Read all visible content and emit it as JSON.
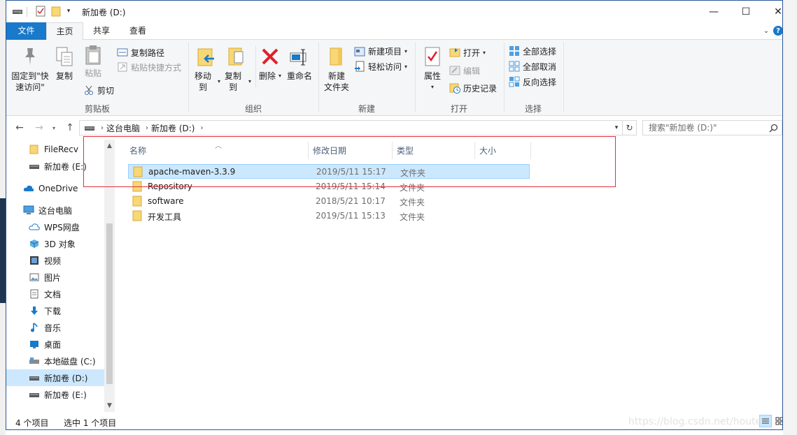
{
  "window": {
    "title": "新加卷 (D:)",
    "controls": {
      "minimize": "—",
      "maximize": "☐",
      "close": "✕"
    }
  },
  "ribbon_tabs": {
    "file": "文件",
    "home": "主页",
    "share": "共享",
    "view": "查看"
  },
  "ribbon": {
    "clipboard": {
      "pin_line1": "固定到\"快",
      "pin_line2": "速访问\"",
      "copy": "复制",
      "paste": "粘贴",
      "copy_path": "复制路径",
      "paste_shortcut": "粘贴快捷方式",
      "cut": "剪切",
      "label": "剪贴板"
    },
    "organize": {
      "move_to": "移动到",
      "copy_to": "复制到",
      "delete": "删除",
      "rename": "重命名",
      "label": "组织"
    },
    "new": {
      "new_folder_line1": "新建",
      "new_folder_line2": "文件夹",
      "new_item": "新建项目",
      "easy_access": "轻松访问",
      "label": "新建"
    },
    "open": {
      "properties": "属性",
      "open": "打开",
      "edit": "编辑",
      "history": "历史记录",
      "label": "打开"
    },
    "select": {
      "select_all": "全部选择",
      "select_none": "全部取消",
      "invert": "反向选择",
      "label": "选择"
    }
  },
  "address": {
    "crumbs": [
      "这台电脑",
      "新加卷 (D:)"
    ],
    "search_placeholder": "搜索\"新加卷 (D:)\""
  },
  "nav_pane": {
    "items": [
      {
        "label": "FileRecv",
        "icon": "folder-icon"
      },
      {
        "label": "新加卷 (E:)",
        "icon": "drive-icon"
      },
      {
        "label": "OneDrive",
        "icon": "cloud-icon"
      },
      {
        "label": "这台电脑",
        "icon": "computer-icon"
      },
      {
        "label": "WPS网盘",
        "icon": "cloud-icon"
      },
      {
        "label": "3D 对象",
        "icon": "cube-icon"
      },
      {
        "label": "视频",
        "icon": "video-icon"
      },
      {
        "label": "图片",
        "icon": "picture-icon"
      },
      {
        "label": "文档",
        "icon": "document-icon"
      },
      {
        "label": "下载",
        "icon": "download-icon"
      },
      {
        "label": "音乐",
        "icon": "music-icon"
      },
      {
        "label": "桌面",
        "icon": "desktop-icon"
      },
      {
        "label": "本地磁盘 (C:)",
        "icon": "drive-icon"
      },
      {
        "label": "新加卷 (D:)",
        "icon": "drive-icon",
        "selected": true
      },
      {
        "label": "新加卷 (E:)",
        "icon": "drive-icon"
      }
    ]
  },
  "columns": {
    "name": "名称",
    "date": "修改日期",
    "type": "类型",
    "size": "大小"
  },
  "files": [
    {
      "name": "apache-maven-3.3.9",
      "date": "2019/5/11 15:17",
      "type": "文件夹",
      "selected": true
    },
    {
      "name": "Repository",
      "date": "2019/5/11 15:14",
      "type": "文件夹"
    },
    {
      "name": "software",
      "date": "2018/5/21 10:17",
      "type": "文件夹"
    },
    {
      "name": "开发工具",
      "date": "2019/5/11 15:13",
      "type": "文件夹"
    }
  ],
  "status": {
    "count": "4 个项目",
    "selection": "选中 1 个项目"
  },
  "watermark": "https://blog.csdn.net/houte",
  "colors": {
    "accent": "#1979ca",
    "selection": "#cce8ff",
    "highlight_box": "#e0303a",
    "folder": "#f8d775"
  }
}
